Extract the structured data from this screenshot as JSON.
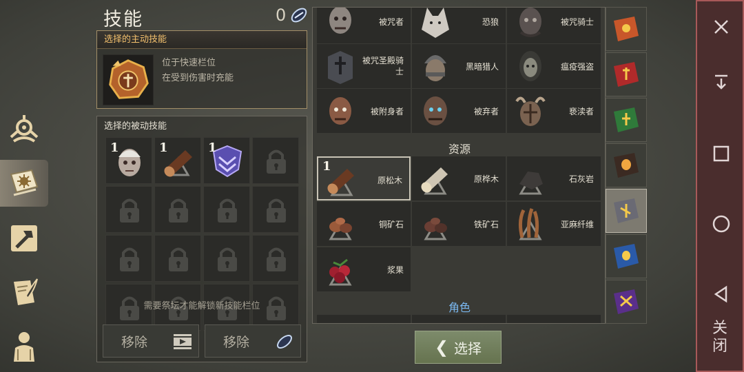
{
  "header": {
    "title": "技能",
    "skill_points": "0"
  },
  "active_skill": {
    "header": "选择的主动技能",
    "desc_line1": "位于快速栏位",
    "desc_line2": "在受到伤害时充能"
  },
  "passive": {
    "header": "选择的被动技能",
    "slots": [
      {
        "icon": "undead-head-icon",
        "count": "1"
      },
      {
        "icon": "pine-log-icon",
        "count": "1"
      },
      {
        "icon": "crystal-shield-icon",
        "count": "1"
      }
    ],
    "locked_count": 13,
    "hint": "需要祭坛才能解锁新技能栏位"
  },
  "remove_buttons": {
    "video_label": "移除",
    "gem_label": "移除"
  },
  "list": {
    "enemies": [
      {
        "name": "被咒者",
        "icon": "cursed-head-icon"
      },
      {
        "name": "恐狼",
        "icon": "dire-wolf-icon"
      },
      {
        "name": "被咒骑士",
        "icon": "cursed-knight-icon"
      },
      {
        "name": "被咒圣殿骑士",
        "icon": "templar-helm-icon"
      },
      {
        "name": "黑暗猎人",
        "icon": "dark-hunter-icon"
      },
      {
        "name": "瘟疫强盗",
        "icon": "plague-bandit-icon"
      },
      {
        "name": "被附身者",
        "icon": "possessed-icon"
      },
      {
        "name": "被弃者",
        "icon": "forsaken-icon"
      },
      {
        "name": "亵渎者",
        "icon": "defiler-icon"
      }
    ],
    "resources_title": "资源",
    "resources": [
      {
        "name": "原松木",
        "icon": "pine-log-icon",
        "count": "1"
      },
      {
        "name": "原桦木",
        "icon": "birch-log-icon",
        "count": ""
      },
      {
        "name": "石灰岩",
        "icon": "limestone-icon",
        "count": ""
      },
      {
        "name": "铜矿石",
        "icon": "copper-ore-icon",
        "count": ""
      },
      {
        "name": "铁矿石",
        "icon": "iron-ore-icon",
        "count": ""
      },
      {
        "name": "亚麻纤维",
        "icon": "flax-fiber-icon",
        "count": ""
      },
      {
        "name": "浆果",
        "icon": "berries-icon",
        "count": ""
      }
    ],
    "roles_title": "角色"
  },
  "select_button": {
    "label": "选择"
  },
  "system": {
    "close_label": "关闭"
  },
  "colors": {
    "accent_orange": "#f3c06d",
    "accent_blue": "#7ab8f0",
    "select_green": "#6f7c57",
    "sysbar_red": "#4a2d2d"
  }
}
